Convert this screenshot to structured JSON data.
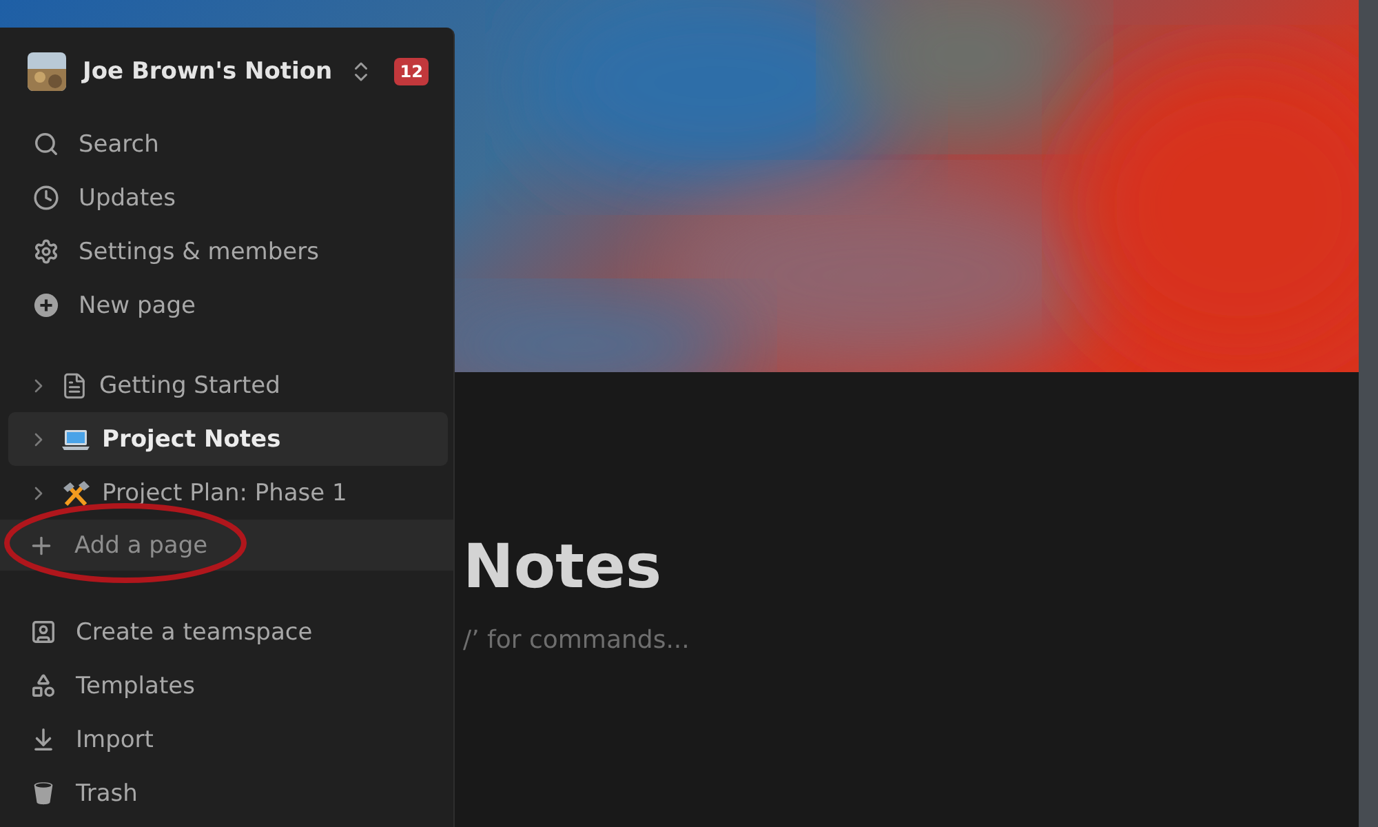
{
  "workspace": {
    "name": "Joe Brown's Notion",
    "badge": "12"
  },
  "menu": [
    {
      "label": "Search",
      "kind": "search"
    },
    {
      "label": "Updates",
      "kind": "clock"
    },
    {
      "label": "Settings & members",
      "kind": "gear"
    },
    {
      "label": "New page",
      "kind": "plus-circle"
    }
  ],
  "pages": [
    {
      "label": "Getting Started",
      "kind": "document",
      "selected": false
    },
    {
      "label": "Project Notes",
      "kind": "laptop",
      "selected": true
    },
    {
      "label": "Project Plan: Phase 1",
      "kind": "tools",
      "selected": false
    }
  ],
  "add_page": {
    "label": "Add a page",
    "circled": true
  },
  "footer_menu": [
    {
      "label": "Create a teamspace",
      "kind": "teamspace"
    },
    {
      "label": "Templates",
      "kind": "shapes"
    },
    {
      "label": "Import",
      "kind": "import"
    },
    {
      "label": "Trash",
      "kind": "trash"
    }
  ],
  "editor": {
    "title": "Notes",
    "placeholder": "/’ for commands..."
  }
}
